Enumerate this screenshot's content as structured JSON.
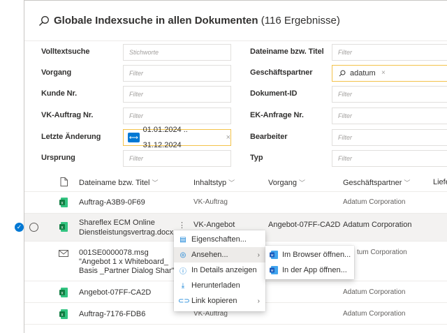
{
  "title": {
    "bold": "Globale Indexsuche in allen Dokumenten",
    "count": "(116 Ergebnisse)"
  },
  "filters": {
    "volltextsuche": {
      "label": "Volltextsuche",
      "placeholder": "Stichworte"
    },
    "vorgang": {
      "label": "Vorgang",
      "placeholder": "Filter"
    },
    "kunde_nr": {
      "label": "Kunde Nr.",
      "placeholder": "Filter"
    },
    "vk_auftrag": {
      "label": "VK-Auftrag Nr.",
      "placeholder": "Filter"
    },
    "letzte_aenderung": {
      "label": "Letzte Änderung",
      "value": "01.01.2024 .. 31.12.2024",
      "remove": "×"
    },
    "ursprung": {
      "label": "Ursprung",
      "placeholder": "Filter"
    },
    "dateiname": {
      "label": "Dateiname bzw. Titel",
      "placeholder": "Filter"
    },
    "geschaeftspartner": {
      "label": "Geschäftspartner",
      "value": "adatum",
      "remove": "×"
    },
    "dokument_id": {
      "label": "Dokument-ID",
      "placeholder": "Filter"
    },
    "ek_anfrage": {
      "label": "EK-Anfrage Nr.",
      "placeholder": "Filter"
    },
    "bearbeiter": {
      "label": "Bearbeiter",
      "placeholder": "Filter"
    },
    "typ": {
      "label": "Typ",
      "placeholder": "Filter"
    }
  },
  "columns": {
    "name": "Dateiname bzw. Titel",
    "content_type": "Inhaltstyp",
    "vorgang": "Vorgang",
    "partner": "Geschäftspartner",
    "liefer": "Liefe"
  },
  "rows": [
    {
      "icon": "excel-icon",
      "name": "Auftrag-A3B9-0F69",
      "type": "VK-Auftrag",
      "vorgang": "",
      "partner": "Adatum Corporation"
    },
    {
      "icon": "excel-icon",
      "name_line1": "Shareflex ECM Online",
      "name_line2": "Dienstleistungsvertrag.docx",
      "more": "⋮",
      "type": "VK-Angebot",
      "vorgang": "Angebot-07FF-CA2D",
      "partner": "Adatum Corporation",
      "selected": true
    },
    {
      "icon": "mail-icon",
      "name_line1": "001SE0000078.msg",
      "name_line2": "\"Angebot 1 x Whiteboard_",
      "name_line3": "Basis _Partner Dialog Shar\"",
      "partner": "tum Corporation"
    },
    {
      "icon": "excel-icon",
      "name": "Angebot-07FF-CA2D",
      "partner": "Adatum Corporation"
    },
    {
      "icon": "excel-icon",
      "name": "Auftrag-7176-FDB6",
      "type": "VK-Auftrag",
      "partner": "Adatum Corporation"
    }
  ],
  "context_menu": {
    "items": [
      "Eigenschaften...",
      "Ansehen...",
      "In Details anzeigen",
      "Herunterladen",
      "Link kopieren"
    ],
    "submenu": [
      "Im Browser öffnen...",
      "In der App öffnen..."
    ]
  },
  "colors": {
    "accent": "#0078d4",
    "active_border": "#f3c24a",
    "excel": "#217346"
  }
}
